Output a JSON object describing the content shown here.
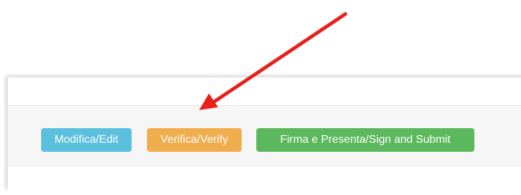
{
  "buttons": {
    "edit_label": "Modifica/Edit",
    "verify_label": "Verifica/Verify",
    "submit_label": "Firma e Presenta/Sign and Submit"
  },
  "colors": {
    "edit": "#5bc0de",
    "verify": "#f0ad4e",
    "submit": "#5cb85c",
    "arrow": "#e8201a"
  },
  "annotation": {
    "icon": "red-arrow-icon",
    "points_to": "verify-button"
  }
}
